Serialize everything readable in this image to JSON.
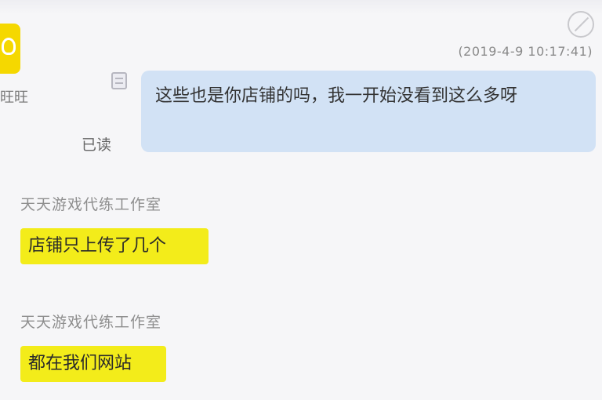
{
  "chat": {
    "timestamp": "(2019-4-9 10:17:41)",
    "side_label": "旺旺",
    "outgoing_message": {
      "text": "这些也是你店铺的吗，我一开始没看到这么多呀",
      "status": "已读"
    },
    "incoming_messages": [
      {
        "sender": "天天游戏代练工作室",
        "text": "店铺只上传了几个"
      },
      {
        "sender": "天天游戏代练工作室",
        "text": "都在我们网站"
      }
    ]
  },
  "colors": {
    "outgoing_bubble": "#d2e2f5",
    "incoming_bubble": "#f3ec1a",
    "avatar": "#f5d800"
  },
  "icons": {
    "avatar": "contact-avatar-icon",
    "corner": "expand-icon",
    "outgoing_marker": "message-icon"
  }
}
